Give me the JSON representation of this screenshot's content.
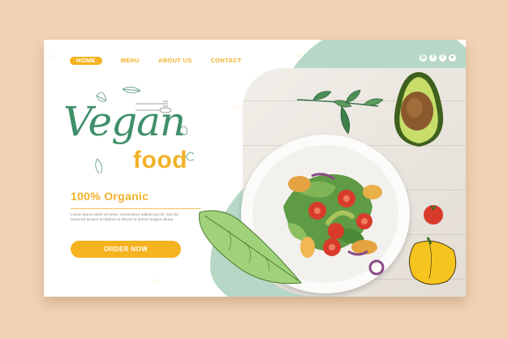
{
  "nav": {
    "items": [
      {
        "label": "HOME",
        "active": true
      },
      {
        "label": "MENU",
        "active": false
      },
      {
        "label": "ABOUT US",
        "active": false
      },
      {
        "label": "CONTACT",
        "active": false
      }
    ]
  },
  "socials": [
    {
      "icon": "instagram-icon",
      "glyph": "◎"
    },
    {
      "icon": "facebook-icon",
      "glyph": "f"
    },
    {
      "icon": "twitter-icon",
      "glyph": "t"
    },
    {
      "icon": "youtube-icon",
      "glyph": "▸"
    }
  ],
  "hero": {
    "title_script": "Vegan",
    "title_food": "food",
    "subtitle": "100% Organic",
    "body": "Lorem ipsum dolor sit amet, consectetur adipiscing elit, sed do eiusmod tempor incididunt ut labore et dolore magna aliqua.",
    "cta_label": "ORDER NOW"
  },
  "colors": {
    "accent_yellow": "#f5b320",
    "brand_green": "#3f8f6a",
    "mint": "#b7d8c6",
    "background": "#f2d2b4"
  }
}
